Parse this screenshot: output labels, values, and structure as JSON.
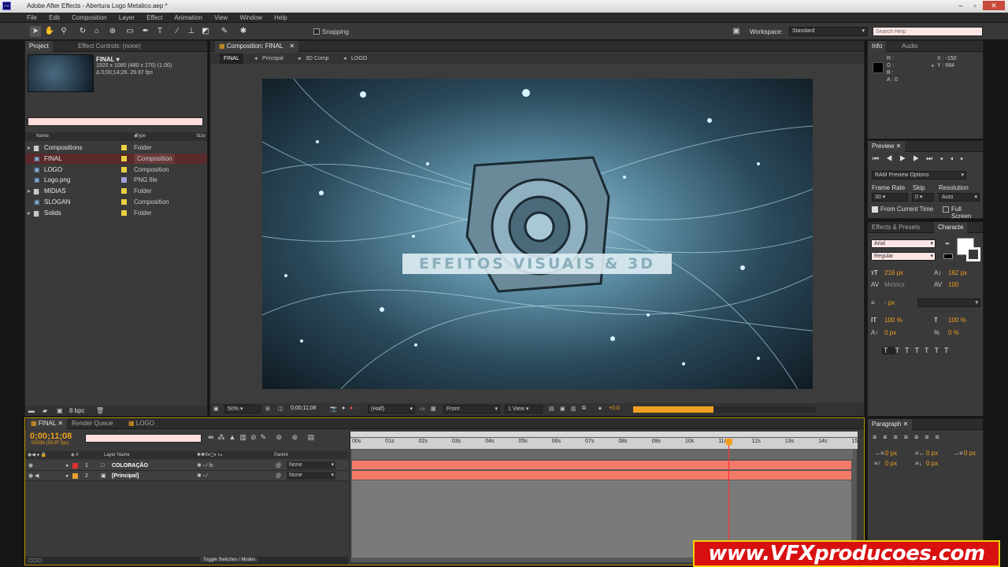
{
  "window": {
    "title": "Adobe After Effects - Abertura Logo Metalico.aep *",
    "app_icon": "Ae"
  },
  "menu": [
    "File",
    "Edit",
    "Composition",
    "Layer",
    "Effect",
    "Animation",
    "View",
    "Window",
    "Help"
  ],
  "toolbar": {
    "snapping": "Snapping",
    "workspace_label": "Workspace:",
    "workspace_value": "Standard",
    "search_placeholder": "Search Help"
  },
  "project": {
    "tab": "Project",
    "tab2": "Effect Controls: (none)",
    "comp_name": "FINAL ▾",
    "comp_info1": "1920 x 1080  (480 x 270) (1.00)",
    "comp_info2": "Δ 0;00;14;28, 29.97 fps",
    "col_name": "Name",
    "col_type": "Type",
    "col_size": "Size",
    "items": [
      {
        "name": "Compositions",
        "type": "Folder",
        "color": "#e8d040"
      },
      {
        "name": "FINAL",
        "type": "Composition",
        "color": "#e8d040"
      },
      {
        "name": "LOGO",
        "type": "Composition",
        "color": "#e8d040"
      },
      {
        "name": "Logo.png",
        "type": "PNG file",
        "color": "#a0a0e0"
      },
      {
        "name": "MIDIAS",
        "type": "Folder",
        "color": "#e8d040"
      },
      {
        "name": "SLOGAN",
        "type": "Composition",
        "color": "#e8d040"
      },
      {
        "name": "Solids",
        "type": "Folder",
        "color": "#e8d040"
      }
    ],
    "bpc": "8 bpc"
  },
  "comp": {
    "tab": "Composition: FINAL",
    "breadcrumbs": [
      "FINAL",
      "Principal",
      "3D Comp",
      "LOGO"
    ],
    "logo_text": "EFEITOS VISUAIS & 3D",
    "zoom": "50%",
    "time": "0;00;11;08",
    "res": "(Half)",
    "view": "Front",
    "views": "1 View",
    "exposure": "+0.0"
  },
  "info": {
    "tab": "Info",
    "tab2": "Audio",
    "r": "R :",
    "g": "G :",
    "b": "B :",
    "a": "A : 0",
    "x": "X : -150",
    "y": "Y : 684"
  },
  "preview": {
    "tab": "Preview",
    "ram": "RAM Preview Options",
    "frame_rate": "Frame Rate",
    "skip": "Skip",
    "resolution": "Resolution",
    "fr_val": "30",
    "skip_val": "0",
    "res_val": "Auto",
    "from_current": "From Current Time",
    "full_screen": "Full Screen"
  },
  "character": {
    "tab1": "Effects & Presets",
    "tab2": "Characte",
    "font": "Arial",
    "style": "Regular",
    "size": "216 px",
    "leading": "162 px",
    "kerning": "Metrics",
    "tracking": "100",
    "stroke": "- px",
    "vscale": "100 %",
    "hscale": "100 %",
    "baseline": "0 px",
    "tsume": "0 %"
  },
  "paragraph": {
    "tab": "Paragraph",
    "v1": "0 px",
    "v2": "0 px",
    "v3": "0 px",
    "v4": "0 px",
    "v5": "0 px"
  },
  "timeline": {
    "tab1": "FINAL",
    "tab2": "Render Queue",
    "tab3": "LOGO",
    "timecode": "0;00;11;08",
    "frames": "00338 (29.97 fps)",
    "col_layer": "Layer Name",
    "col_parent": "Parent",
    "ruler": [
      "00s",
      "01s",
      "02s",
      "03s",
      "04s",
      "05s",
      "06s",
      "07s",
      "08s",
      "09s",
      "10s",
      "11s",
      "12s",
      "13s",
      "14s",
      "15"
    ],
    "layers": [
      {
        "num": "1",
        "name": "COLORAÇÃO",
        "parent": "None",
        "color": "#e03030"
      },
      {
        "num": "2",
        "name": "[Principal]",
        "parent": "None",
        "color": "#e8a030"
      }
    ],
    "toggle": "Toggle Switches / Modes"
  },
  "watermark": "www.VFXproducoes.com",
  "colors": {
    "accent": "#f0a020",
    "bar": "#f47a6a",
    "playhead": "#ff3030"
  }
}
